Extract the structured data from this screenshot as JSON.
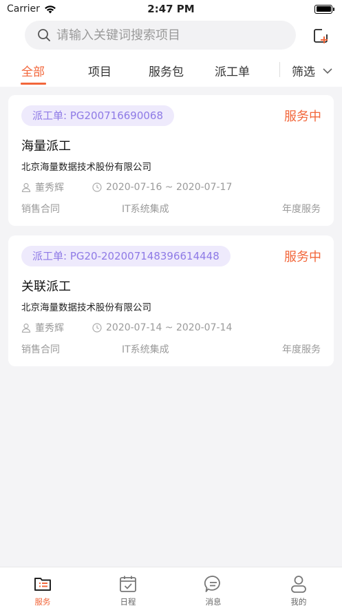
{
  "status_bar": {
    "carrier": "Carrier",
    "time": "2:47 PM"
  },
  "search": {
    "placeholder": "请输入关键词搜索项目"
  },
  "tabs": [
    {
      "label": "全部",
      "active": true
    },
    {
      "label": "项目",
      "active": false
    },
    {
      "label": "服务包",
      "active": false
    },
    {
      "label": "派工单",
      "active": false
    }
  ],
  "filter_label": "筛选",
  "cards": [
    {
      "badge": "派工单: PG200716690068",
      "status": "服务中",
      "title": "海量派工",
      "company": "北京海量数据技术股份有限公司",
      "person": "董秀辉",
      "date_range": "2020-07-16 ~ 2020-07-17",
      "tags": [
        "销售合同",
        "IT系统集成",
        "年度服务"
      ]
    },
    {
      "badge": "派工单: PG20-202007148396614448",
      "status": "服务中",
      "title": "关联派工",
      "company": "北京海量数据技术股份有限公司",
      "person": "董秀辉",
      "date_range": "2020-07-14 ~ 2020-07-14",
      "tags": [
        "销售合同",
        "IT系统集成",
        "年度服务"
      ]
    }
  ],
  "tab_bar": [
    {
      "label": "服务",
      "icon": "folder-list-icon",
      "active": true
    },
    {
      "label": "日程",
      "icon": "calendar-check-icon",
      "active": false
    },
    {
      "label": "消息",
      "icon": "chat-bubble-icon",
      "active": false
    },
    {
      "label": "我的",
      "icon": "user-icon",
      "active": false
    }
  ],
  "colors": {
    "accent": "#f2663a",
    "badge_text": "#8e7ae6",
    "badge_bg": "#eeeafc",
    "background": "#f4f4f6"
  }
}
